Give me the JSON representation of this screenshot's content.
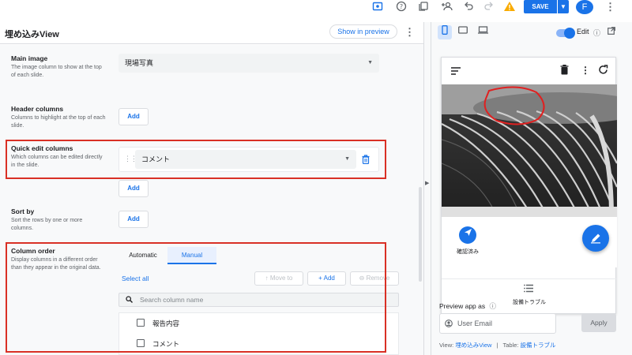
{
  "topbar": {
    "icons": [
      "preview-icon",
      "help-icon",
      "copy-icon",
      "add-person-icon",
      "undo-icon",
      "redo-icon",
      "warning-icon"
    ],
    "save_label": "SAVE",
    "avatar_letter": "F"
  },
  "editor": {
    "title": "埋め込みView",
    "show_preview_label": "Show in preview",
    "main_image": {
      "label": "Main image",
      "desc": "The image column to show at the top of each slide.",
      "value": "現場写真"
    },
    "header_columns": {
      "label": "Header columns",
      "desc": "Columns to highlight at the top of each slide.",
      "add_label": "Add"
    },
    "quick_edit": {
      "label": "Quick edit columns",
      "desc": "Which columns can be edited directly in the slide.",
      "value": "コメント",
      "add_label": "Add"
    },
    "sort_by": {
      "label": "Sort by",
      "desc": "Sort the rows by one or more columns.",
      "add_label": "Add"
    },
    "column_order": {
      "label": "Column order",
      "desc": "Display columns in a different order than they appear in the original data.",
      "tabs": [
        "Automatic",
        "Manual"
      ],
      "active_tab": "Manual",
      "select_all": "Select all",
      "move_to": "Move to",
      "add": "+ Add",
      "remove": "Remove",
      "search_placeholder": "Search column name",
      "columns": [
        "報告内容",
        "コメント"
      ]
    }
  },
  "preview": {
    "edit_label": "Edit",
    "action_label": "確認済み",
    "nav_label": "設備トラブル",
    "preview_as_label": "Preview app as",
    "email_placeholder": "User Email",
    "apply_label": "Apply",
    "view_prefix": "View:",
    "view_name": "埋め込みView",
    "separator": "|",
    "table_prefix": "Table:",
    "table_name": "設備トラブル"
  },
  "colors": {
    "accent": "#1a73e8",
    "highlight_box": "#d93025",
    "warning": "#f9ab00"
  }
}
